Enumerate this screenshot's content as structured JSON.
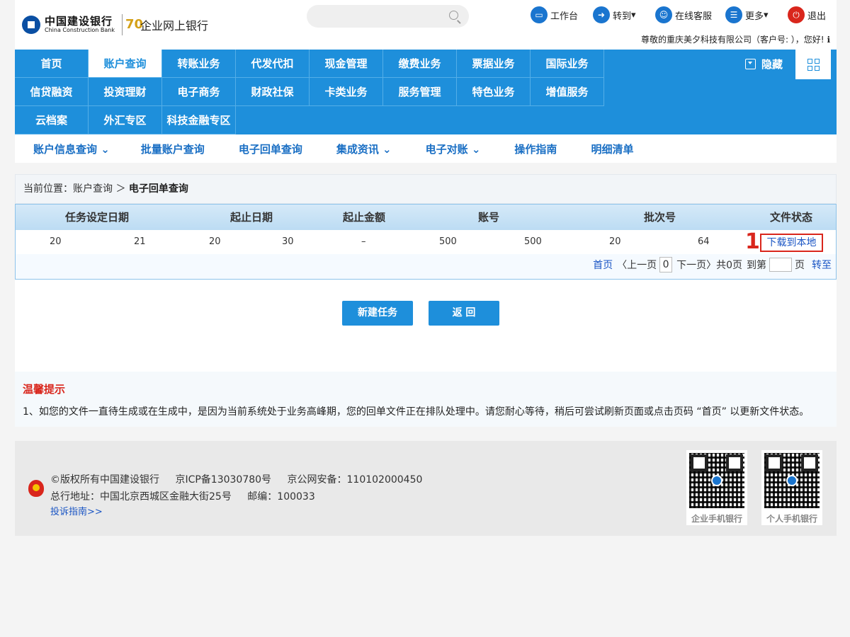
{
  "brand": {
    "name_cn": "中国建设银行",
    "name_en": "China Construction Bank",
    "anniversary": "70",
    "product": "企业网上银行"
  },
  "top_actions": [
    {
      "label": "工作台",
      "icon": "monitor-icon"
    },
    {
      "label": "转到",
      "icon": "forward-icon"
    },
    {
      "label": "在线客服",
      "icon": "service-icon"
    },
    {
      "label": "更多",
      "icon": "more-icon"
    },
    {
      "label": "退出",
      "icon": "power-icon"
    }
  ],
  "greeting": "尊敬的重庆美夕科技有限公司（客户号:                    ），您好!",
  "nav": {
    "items": [
      {
        "label": "首页"
      },
      {
        "label": "账户查询",
        "active": true
      },
      {
        "label": "转账业务"
      },
      {
        "label": "代发代扣"
      },
      {
        "label": "现金管理"
      },
      {
        "label": "缴费业务"
      },
      {
        "label": "票据业务"
      },
      {
        "label": "国际业务"
      },
      {
        "label": "信贷融资"
      },
      {
        "label": "投资理财"
      },
      {
        "label": "电子商务"
      },
      {
        "label": "财政社保"
      },
      {
        "label": "卡类业务"
      },
      {
        "label": "服务管理"
      },
      {
        "label": "特色业务"
      },
      {
        "label": "增值服务"
      },
      {
        "label": "云档案"
      },
      {
        "label": "外汇专区"
      },
      {
        "label": "科技金融专区"
      }
    ],
    "hide_label": "隐藏"
  },
  "subnav": [
    {
      "label": "账户信息查询 ⌄"
    },
    {
      "label": "批量账户查询"
    },
    {
      "label": "电子回单查询"
    },
    {
      "label": "集成资讯 ⌄"
    },
    {
      "label": "电子对账 ⌄"
    },
    {
      "label": "操作指南"
    },
    {
      "label": "明细清单"
    }
  ],
  "breadcrumb": {
    "prefix": "当前位置：账户查询 ＞ ",
    "current": "电子回单查询"
  },
  "table": {
    "headers": [
      "任务设定日期",
      "起止日期",
      "起止金额",
      "账号",
      "批次号",
      "文件状态"
    ],
    "row": {
      "cells": [
        "20",
        "21",
        "20",
        "30",
        "–",
        "500",
        "500",
        "20",
        "64"
      ],
      "action": "下载到本地",
      "marker": "1"
    }
  },
  "pager": {
    "first": "首页",
    "prev": "〈上一页",
    "current": "0",
    "next": "下一页〉共0页",
    "goto_prefix": "到第",
    "goto_suffix": "页",
    "go": "转至"
  },
  "buttons": {
    "new_task": "新建任务",
    "back": "返  回"
  },
  "tips": {
    "title": "温馨提示",
    "text": "1、如您的文件一直待生成或在生成中，是因为当前系统处于业务高峰期，您的回单文件正在排队处理中。请您耐心等待，稍后可尝试刷新页面或点击页码 “首页” 以更新文件状态。"
  },
  "footer": {
    "copyright": "©版权所有中国建设银行",
    "icp": "京ICP备13030780号",
    "police": "京公网安备：110102000450",
    "address": "总行地址：中国北京西城区金融大街25号",
    "postcode": "邮编：100033",
    "complaint": "投诉指南>>",
    "qr_corporate": "企业手机银行",
    "qr_personal": "个人手机银行"
  },
  "colors": {
    "nav_blue": "#1e8fdb",
    "link_blue": "#1a55c4",
    "alert_red": "#d9261c"
  }
}
